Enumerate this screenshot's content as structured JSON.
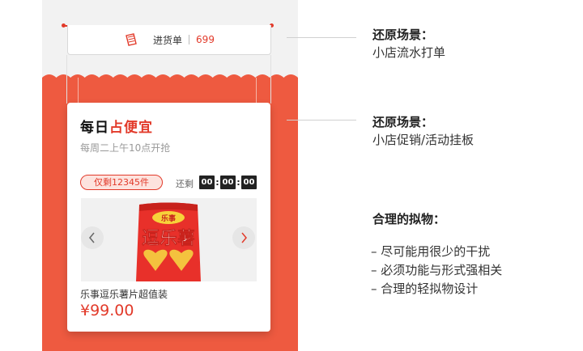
{
  "receipt": {
    "label": "进货单",
    "count": "699"
  },
  "card": {
    "title_part1": "每日",
    "title_part2": "占便宜",
    "subtitle": "每周二上午10点开抢",
    "stock_badge": "仅剩12345件",
    "countdown_label": "还剩",
    "countdown": {
      "h": "00",
      "m": "00",
      "s": "00"
    },
    "product_brand": "乐事",
    "product_bag_text": "逗乐薯",
    "product_name": "乐事逗乐薯片超值装",
    "price": "¥99.00"
  },
  "annotations": [
    {
      "heading": "还原场景：",
      "body": "小店流水打单"
    },
    {
      "heading": "还原场景：",
      "body": "小店促销/活动挂板"
    },
    {
      "heading": "合理的拟物："
    }
  ],
  "bullets": [
    "– 尽可能用很少的干扰",
    "– 必须功能与形式强相关",
    "– 合理的轻拟物设计"
  ],
  "colors": {
    "accent": "#e23a2a",
    "banner": "#ee5a40",
    "phone_bg": "#f2f2f2"
  },
  "icons": {
    "receipt": "clipboard-list-icon",
    "prev": "chevron-left-icon",
    "next": "chevron-right-icon"
  }
}
